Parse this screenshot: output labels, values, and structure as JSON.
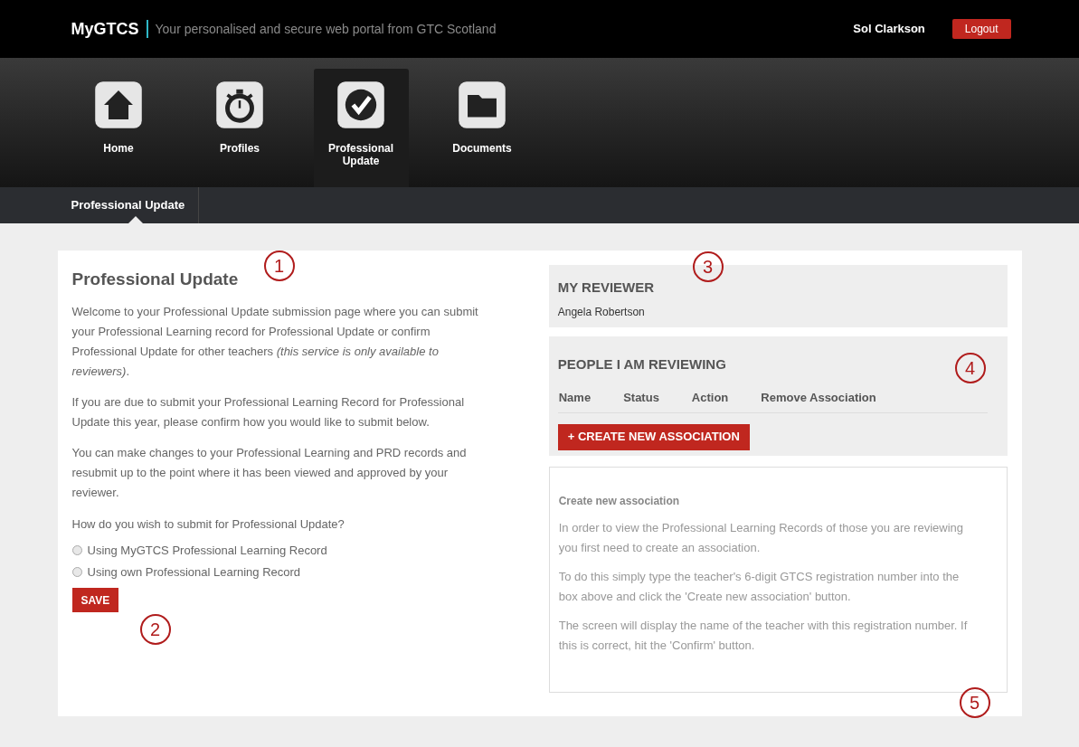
{
  "header": {
    "brand": "MyGTCS",
    "tagline": "Your personalised and secure web portal from GTC Scotland",
    "user": "Sol Clarkson",
    "logout": "Logout"
  },
  "nav": [
    {
      "label": "Home",
      "selected": false
    },
    {
      "label": "Profiles",
      "selected": false
    },
    {
      "label": "Professional Update",
      "selected": true
    },
    {
      "label": "Documents",
      "selected": false
    }
  ],
  "subnav": [
    {
      "label": "Professional Update",
      "selected": true
    }
  ],
  "main": {
    "title": "Professional Update",
    "paragraphs": [
      "Welcome to your Professional Update submission page where you can submit your Professional Learning record for Professional Update or confirm Professional Update for other teachers *(this service is only available to reviewers)*.",
      "If you are due to submit your Professional Learning Record for Professional Update this year, please confirm how you would like to submit below.",
      "You can make changes to your Professional Learning and PRD records and resubmit up to the point where it has been viewed and approved by your reviewer."
    ],
    "question": "How do you wish to submit for Professional Update?",
    "options": [
      {
        "label": "Using MyGTCS Professional Learning Record",
        "selected": false
      },
      {
        "label": "Using own Professional Learning Record",
        "selected": false
      }
    ],
    "save": "SAVE"
  },
  "my_reviewer": {
    "title": "MY REVIEWER",
    "name": "Angela Robertson"
  },
  "reviewing": {
    "title": "PEOPLE I AM REVIEWING",
    "columns": [
      "Name",
      "Status",
      "Action",
      "Remove Association"
    ],
    "button": "+ CREATE NEW ASSOCIATION"
  },
  "help": {
    "title": "Create new association",
    "paragraphs": [
      "In order to view the Professional Learning Records of those you are reviewing you first need to create an association.",
      "To do this simply type the teacher's 6-digit GTCS registration number into the box above and click the 'Create new association' button.",
      "The screen will display the name of the teacher with this registration number. If this is correct, hit the 'Confirm' button."
    ]
  },
  "callouts": [
    "1",
    "2",
    "3",
    "4",
    "5"
  ]
}
